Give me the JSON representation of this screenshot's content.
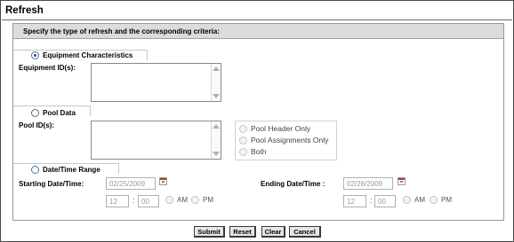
{
  "page": {
    "title": "Refresh"
  },
  "panel": {
    "heading": "Specify the type of refresh and the corresponding criteria:"
  },
  "equipment": {
    "option_label": "Equipment Characteristics",
    "field_label": "Equipment ID(s):",
    "selected": true
  },
  "pool": {
    "option_label": "Pool Data",
    "field_label": "Pool ID(s):",
    "sub_options": [
      "Pool Header Only",
      "Pool Assignments Only",
      "Both"
    ]
  },
  "datetime": {
    "option_label": "Date/Time Range",
    "starting": {
      "label": "Starting Date/Time:",
      "date": "02/25/2009",
      "hour": "12",
      "minute": "00",
      "am_label": "AM",
      "pm_label": "PM",
      "colon": ":"
    },
    "ending": {
      "label": "Ending Date/Time :",
      "date": "02/26/2009",
      "hour": "12",
      "minute": "00",
      "am_label": "AM",
      "pm_label": "PM",
      "colon": ":"
    }
  },
  "buttons": {
    "submit": "Submit",
    "reset": "Reset",
    "clear": "Clear",
    "cancel": "Cancel"
  },
  "icons": {
    "radio": "radio-icon",
    "calendar": "calendar-icon",
    "scroll_up": "scroll-up-arrow-icon",
    "scroll_down": "scroll-down-arrow-icon"
  },
  "colors": {
    "panel_header": "#dcdcdc",
    "radio_border": "#4c6e9a",
    "calendar_accent": "#c0392b"
  }
}
